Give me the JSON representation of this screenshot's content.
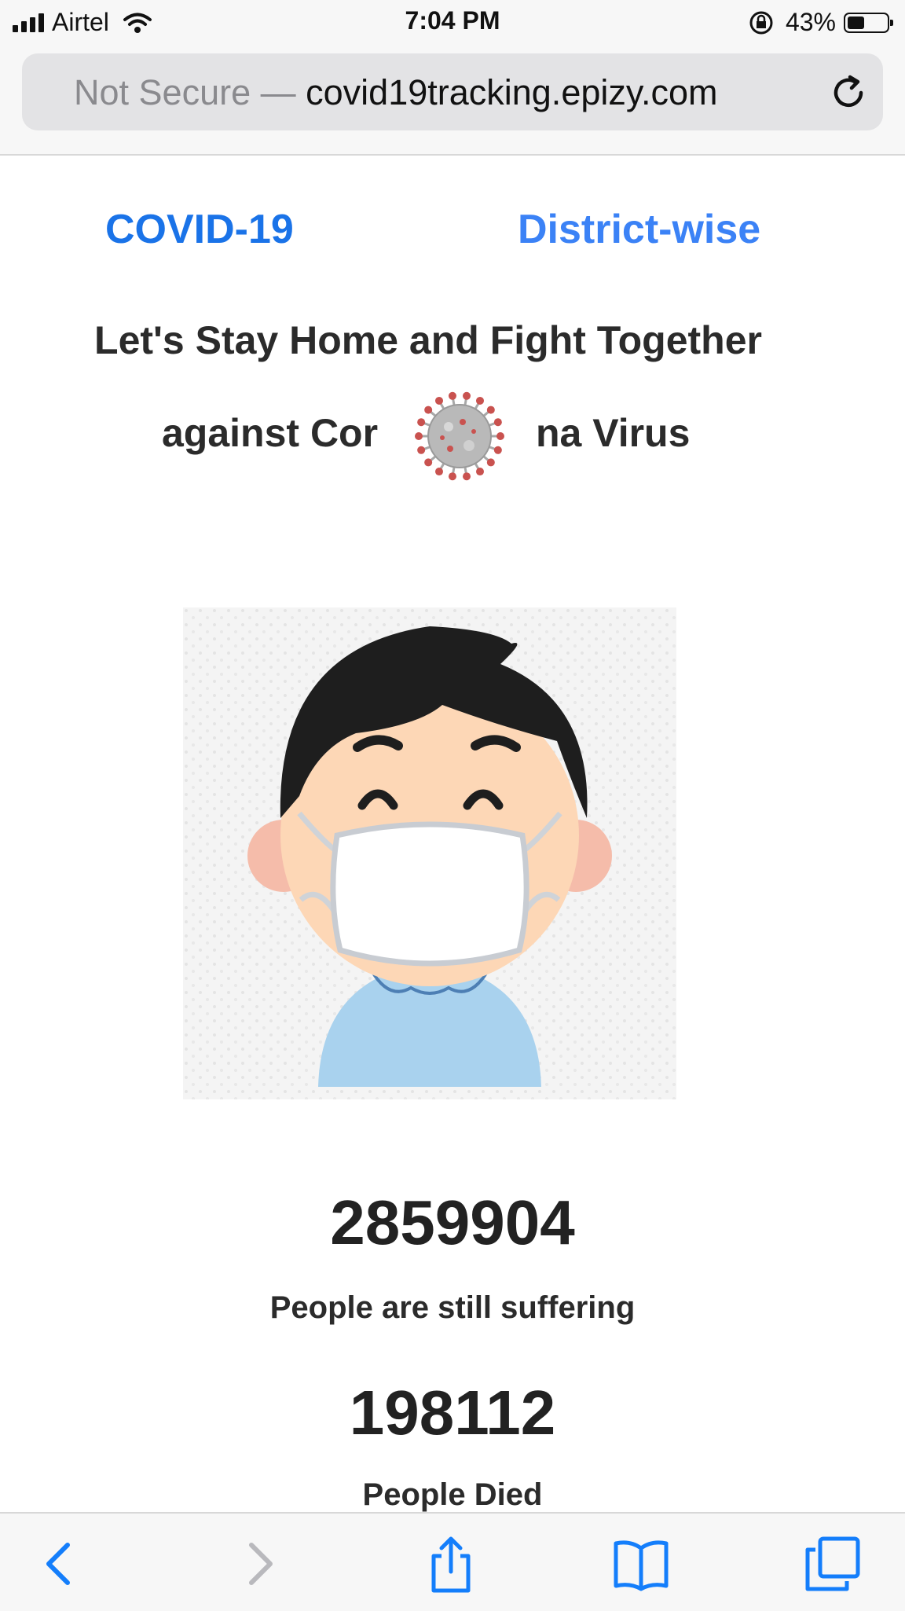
{
  "status_bar": {
    "carrier": "Airtel",
    "time": "7:04 PM",
    "battery_percent": "43%",
    "battery_level": 0.43,
    "icons": [
      "signal-icon",
      "wifi-icon",
      "rotation-lock-icon",
      "battery-icon"
    ]
  },
  "address_bar": {
    "security_label": "Not Secure —",
    "host": "covid19tracking.epizy.com",
    "reload_icon": "reload-icon"
  },
  "nav": {
    "left_link": "COVID-19",
    "right_link": "District-wise"
  },
  "hero": {
    "line1": "Let's Stay Home and Fight Together",
    "line2_before": "against Cor",
    "line2_after": "na Virus",
    "virus_icon": "coronavirus-icon",
    "illustration": "masked-boy-illustration"
  },
  "stats": [
    {
      "value": "2859904",
      "label": "People are still suffering"
    },
    {
      "value": "198112",
      "label": "People Died"
    }
  ],
  "bottom_bar": {
    "icons": [
      "back-icon",
      "forward-icon",
      "share-icon",
      "bookmarks-icon",
      "tabs-icon"
    ]
  },
  "colors": {
    "link": "#1a73e8",
    "text": "#222222",
    "chrome_bg": "#f7f7f7",
    "ios_blue": "#147efb"
  }
}
